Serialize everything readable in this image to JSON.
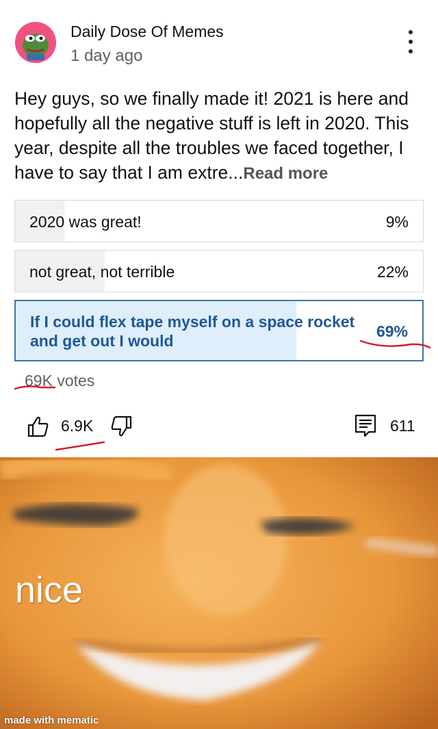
{
  "post": {
    "channel_name": "Daily Dose Of Memes",
    "time_ago": "1 day ago",
    "text": "Hey guys, so we finally made it! 2021 is here and hopefully all the negative stuff is left in 2020. This year, despite all the troubles we faced together, I have to say that I am extre...",
    "read_more": "Read more",
    "icons": {
      "avatar": "pepe-frog-avatar",
      "menu": "more-vert-icon"
    }
  },
  "poll": {
    "options": [
      {
        "label": "2020 was great!",
        "percent_text": "9%",
        "percent": 9,
        "selected": false
      },
      {
        "label": "not great, not terrible",
        "percent_text": "22%",
        "percent": 22,
        "selected": false
      },
      {
        "label": "If I could flex tape myself on a space rocket and get out I would",
        "percent_text": "69%",
        "percent": 69,
        "selected": true
      }
    ],
    "votes": "69K votes",
    "selected_color": "#1f5896",
    "selected_border": "#3e75a8",
    "selected_fill": "#deeefb"
  },
  "engagement": {
    "likes": "6.9K",
    "comments": "611",
    "icons": {
      "like": "thumb-up-icon",
      "dislike": "thumb-down-icon",
      "comment": "comment-icon"
    }
  },
  "annotation_color": "#d21f2a",
  "meme": {
    "caption": "nice",
    "watermark": "made with mematic"
  }
}
